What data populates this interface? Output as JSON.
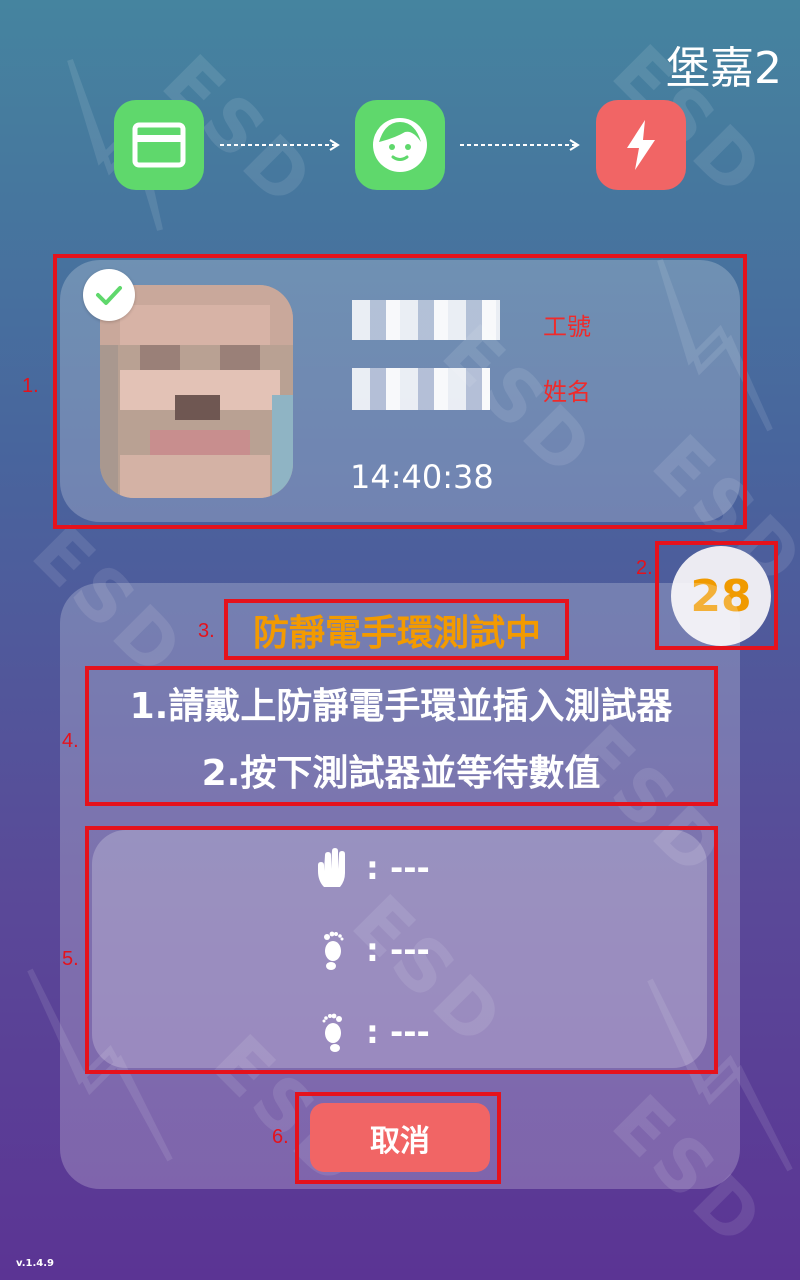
{
  "header": {
    "station_name": "堡嘉2"
  },
  "steps": [
    {
      "icon": "card-icon",
      "color": "#5fd86c"
    },
    {
      "icon": "face-icon",
      "color": "#5fd86c"
    },
    {
      "icon": "lightning-icon",
      "color": "#f16565"
    }
  ],
  "watermark": "ESD",
  "user": {
    "verified": true,
    "employee_id_label": "工號",
    "name_label": "姓名",
    "time": "14:40:38"
  },
  "countdown": "28",
  "test": {
    "status": "防靜電手環測試中",
    "instruction_1": "1.請戴上防靜電手環並插入測試器",
    "instruction_2": "2.按下測試器並等待數值",
    "readings": [
      {
        "icon": "hand-icon",
        "value": ": ---"
      },
      {
        "icon": "left-foot-icon",
        "value": ": ---"
      },
      {
        "icon": "right-foot-icon",
        "value": ": ---"
      }
    ],
    "cancel_label": "取消"
  },
  "annotations": [
    "1.",
    "2.",
    "3.",
    "4.",
    "5.",
    "6."
  ],
  "version": "v.1.4.9",
  "colors": {
    "success": "#5fd86c",
    "danger": "#f16565",
    "status": "#f39a00",
    "annotation": "#e5121c"
  }
}
